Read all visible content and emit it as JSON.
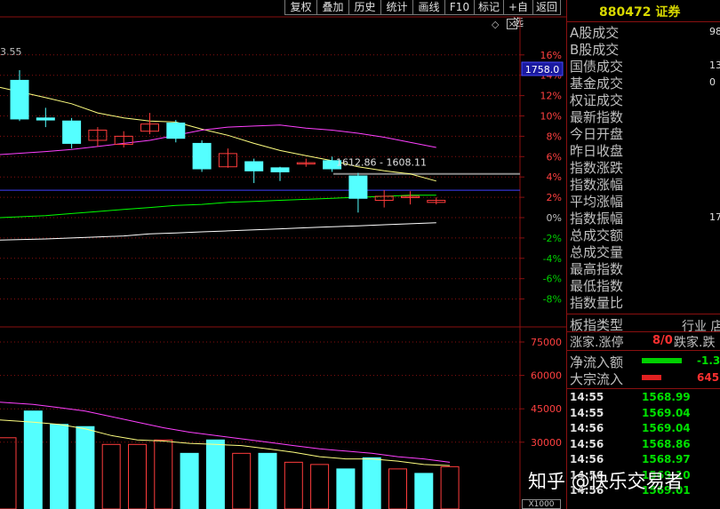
{
  "toolbar": {
    "buttons": [
      {
        "label": "复权"
      },
      {
        "label": "叠加"
      },
      {
        "label": "历史"
      },
      {
        "label": "统计"
      },
      {
        "label": "画线"
      },
      {
        "label": "F10"
      },
      {
        "label": "标记"
      },
      {
        "label": "+自选"
      },
      {
        "label": "返回"
      }
    ]
  },
  "chart": {
    "top_left_price": "3.55",
    "price_tag": "1758.0",
    "range_label": "1612.86 - 1608.11",
    "pct_ticks": [
      "16%",
      "14%",
      "12%",
      "10%",
      "8%",
      "6%",
      "4%",
      "2%",
      "0%",
      "-2%",
      "-4%",
      "-6%",
      "-8%"
    ],
    "vol_ticks": [
      "75000",
      "60000",
      "45000",
      "30000"
    ],
    "vol_unit": "X1000",
    "colors": {
      "up": "#ff3c3c",
      "down": "#54ffff",
      "ma5": "#ffffff",
      "ma10": "#ffff80",
      "ma20": "#ff40ff",
      "ma60": "#00ff00",
      "bg": "#000000",
      "grid": "#8a1010"
    }
  },
  "chart_data": [
    {
      "type": "candlestick",
      "title": "",
      "ylabel_right": "",
      "ylim_pct": [
        -9,
        17
      ],
      "candles": [
        {
          "open": 13.5,
          "close": 9.7,
          "high": 14.5,
          "low": 9.5
        },
        {
          "open": 9.8,
          "close": 9.6,
          "high": 10.8,
          "low": 8.9
        },
        {
          "open": 9.5,
          "close": 7.3,
          "high": 9.8,
          "low": 6.8
        },
        {
          "open": 7.6,
          "close": 8.6,
          "high": 8.9,
          "low": 7.0
        },
        {
          "open": 7.2,
          "close": 8.0,
          "high": 8.5,
          "low": 6.9
        },
        {
          "open": 8.5,
          "close": 9.2,
          "high": 10.3,
          "low": 8.2
        },
        {
          "open": 9.3,
          "close": 7.8,
          "high": 9.6,
          "low": 7.4
        },
        {
          "open": 7.3,
          "close": 4.8,
          "high": 7.6,
          "low": 4.5
        },
        {
          "open": 5.0,
          "close": 6.3,
          "high": 6.8,
          "low": 4.9
        },
        {
          "open": 5.5,
          "close": 4.6,
          "high": 5.8,
          "low": 3.4
        },
        {
          "open": 4.9,
          "close": 4.5,
          "high": 5.0,
          "low": 3.6
        },
        {
          "open": 5.4,
          "close": 5.4,
          "high": 5.8,
          "low": 5.0
        },
        {
          "open": 5.6,
          "close": 4.8,
          "high": 6.0,
          "low": 4.5
        },
        {
          "open": 4.1,
          "close": 1.9,
          "high": 4.4,
          "low": 0.5
        },
        {
          "open": 1.7,
          "close": 2.1,
          "high": 2.7,
          "low": 1.0
        },
        {
          "open": 2.1,
          "close": 2.1,
          "high": 2.6,
          "low": 1.3
        },
        {
          "open": 1.5,
          "close": 1.7,
          "high": 2.0,
          "low": 1.3
        }
      ],
      "ma_lines": [
        {
          "name": "",
          "color": "#ffff80",
          "values": [
            12.8,
            11.8,
            11.2,
            10.3,
            9.8,
            9.5,
            9.4,
            8.7,
            8.1,
            7.3,
            6.6,
            6.1,
            5.6,
            5.0,
            4.6,
            4.3,
            3.6
          ]
        },
        {
          "name": "",
          "color": "#ff40ff",
          "values": [
            6.2,
            6.5,
            6.7,
            7.0,
            7.3,
            7.6,
            8.1,
            8.6,
            8.9,
            9.0,
            9.1,
            8.8,
            8.6,
            8.3,
            7.9,
            7.4,
            6.9
          ]
        },
        {
          "name": "",
          "color": "#00ff00",
          "values": [
            0.0,
            0.2,
            0.4,
            0.6,
            0.8,
            1.0,
            1.2,
            1.3,
            1.5,
            1.6,
            1.7,
            1.8,
            1.9,
            2.0,
            2.1,
            2.2,
            2.2
          ]
        },
        {
          "name": "",
          "color": "#ffffff",
          "values": [
            -2.2,
            -2.1,
            -2.0,
            -1.9,
            -1.8,
            -1.6,
            -1.5,
            -1.4,
            -1.3,
            -1.2,
            -1.1,
            -1.0,
            -0.9,
            -0.8,
            -0.7,
            -0.6,
            -0.5
          ]
        }
      ],
      "horizontal_lines": [
        {
          "color": "#4040ff",
          "value": 2.7
        },
        {
          "color": "#888888",
          "value": 4.3
        }
      ]
    },
    {
      "type": "bar",
      "title": "",
      "ylim": [
        0,
        80000
      ],
      "values": [
        32000,
        44000,
        38000,
        37000,
        29000,
        29000,
        31000,
        25000,
        31000,
        25000,
        25000,
        21000,
        20000,
        18000,
        23000,
        18000,
        16000,
        19000
      ],
      "direction": [
        "up",
        "down",
        "down",
        "down",
        "up",
        "up",
        "up",
        "down",
        "down",
        "up",
        "down",
        "up",
        "up",
        "down",
        "down",
        "up",
        "down",
        "up"
      ],
      "ma_lines": [
        {
          "color": "#ff40ff",
          "values": [
            48000,
            47000,
            45500,
            44000,
            41500,
            39000,
            36500,
            34500,
            33000,
            31500,
            30000,
            28500,
            27000,
            26000,
            25000,
            23500,
            22500,
            21000
          ]
        },
        {
          "color": "#ffff80",
          "values": [
            40000,
            39000,
            38000,
            36000,
            33000,
            31000,
            30500,
            29500,
            29000,
            28500,
            27000,
            25500,
            23500,
            22500,
            22500,
            21500,
            20000,
            19500
          ]
        }
      ]
    }
  ],
  "panel": {
    "code": "880472",
    "name": "证券",
    "rows": [
      {
        "label": "A股成交",
        "value": "98"
      },
      {
        "label": "B股成交",
        "value": ""
      },
      {
        "label": "国债成交",
        "value": "13"
      },
      {
        "label": "基金成交",
        "value": "0"
      },
      {
        "label": "权证成交",
        "value": ""
      },
      {
        "label": "最新指数",
        "value": ""
      },
      {
        "label": "今日开盘",
        "value": ""
      },
      {
        "label": "昨日收盘",
        "value": ""
      },
      {
        "label": "指数涨跌",
        "value": ""
      },
      {
        "label": "指数涨幅",
        "value": ""
      },
      {
        "label": "平均涨幅",
        "value": ""
      },
      {
        "label": "指数振幅",
        "value": "17."
      },
      {
        "label": "总成交额",
        "value": ""
      },
      {
        "label": "总成交量",
        "value": ""
      },
      {
        "label": "最高指数",
        "value": ""
      },
      {
        "label": "最低指数",
        "value": ""
      },
      {
        "label": "指数量比",
        "value": ""
      }
    ],
    "sector_type_label": "板指类型",
    "sector_type_value": "行业 店",
    "up_label": "涨家.涨停",
    "up_value": "8/0",
    "down_label": "跌家.跌",
    "net_inflow_label": "净流入额",
    "net_inflow_value": "-1.3",
    "block_inflow_label": "大宗流入",
    "block_inflow_value": "645",
    "net_bar_color": "#00d000",
    "block_bar_color": "#e02020",
    "ticks": [
      {
        "time": "14:55",
        "price": "1568.99"
      },
      {
        "time": "14:55",
        "price": "1569.04"
      },
      {
        "time": "14:56",
        "price": "1569.04"
      },
      {
        "time": "14:56",
        "price": "1568.86"
      },
      {
        "time": "14:56",
        "price": "1568.97"
      },
      {
        "time": "14:56",
        "price": "1569.10"
      },
      {
        "time": "14:56",
        "price": "1569.01"
      }
    ]
  },
  "watermark": "知乎 @快乐交易者"
}
